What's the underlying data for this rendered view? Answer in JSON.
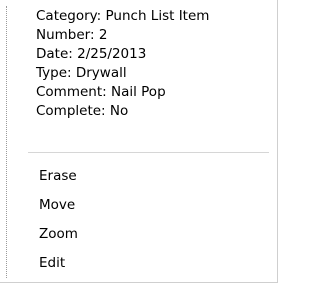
{
  "info": {
    "category": "Category: Punch List Item",
    "number": "Number: 2",
    "date": "Date: 2/25/2013",
    "type": "Type: Drywall",
    "comment": "Comment: Nail Pop",
    "complete": "Complete: No"
  },
  "menu": {
    "items": [
      {
        "label": "Erase"
      },
      {
        "label": "Move"
      },
      {
        "label": "Zoom"
      },
      {
        "label": "Edit"
      }
    ]
  }
}
